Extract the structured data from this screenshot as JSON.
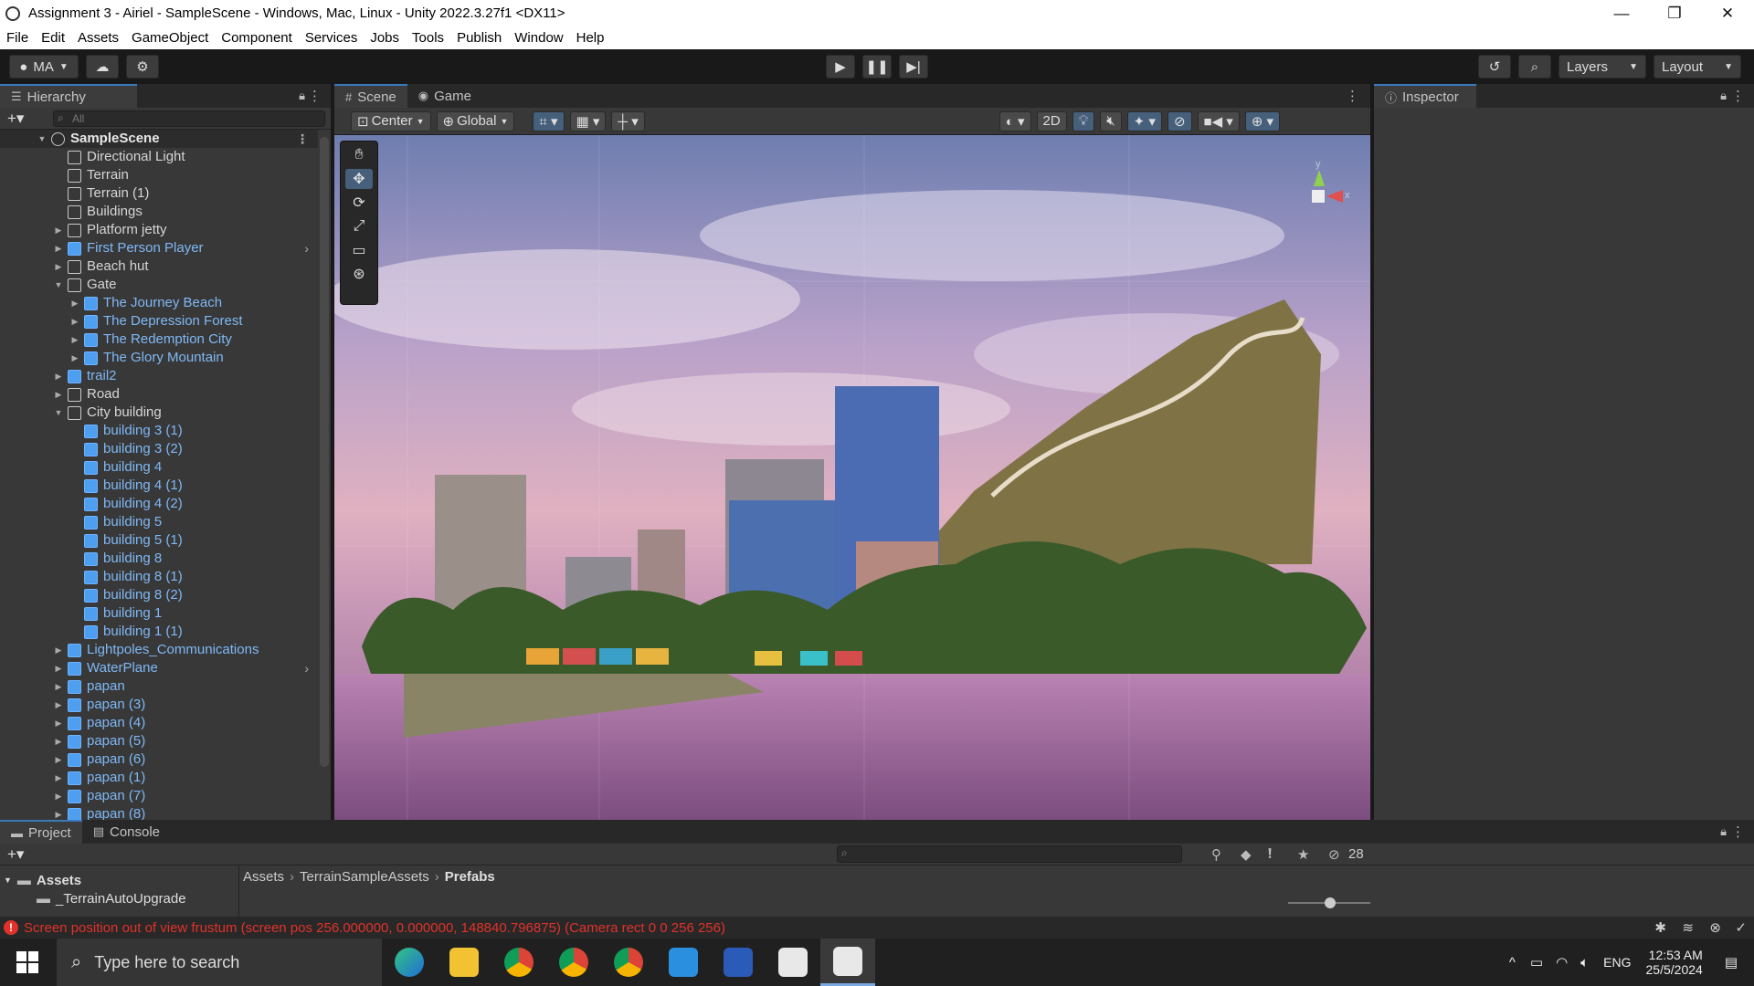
{
  "window": {
    "title": "Assignment 3 - Airiel - SampleScene - Windows, Mac, Linux - Unity 2022.3.27f1 <DX11>",
    "controls": [
      "—",
      "❐",
      "✕"
    ]
  },
  "menu": [
    "File",
    "Edit",
    "Assets",
    "GameObject",
    "Component",
    "Services",
    "Jobs",
    "Tools",
    "Publish",
    "Window",
    "Help"
  ],
  "toolbar": {
    "account": "MA",
    "layers_label": "Layers",
    "layout_label": "Layout"
  },
  "hierarchy": {
    "tab": "Hierarchy",
    "search_placeholder": "All",
    "scene": "SampleScene",
    "items": [
      {
        "label": "Directional Light",
        "depth": 1,
        "arrow": "",
        "prefab": false
      },
      {
        "label": "Terrain",
        "depth": 1,
        "arrow": "",
        "prefab": false
      },
      {
        "label": "Terrain (1)",
        "depth": 1,
        "arrow": "",
        "prefab": false
      },
      {
        "label": "Buildings",
        "depth": 1,
        "arrow": "",
        "prefab": false
      },
      {
        "label": "Platform jetty",
        "depth": 1,
        "arrow": "▶",
        "prefab": false
      },
      {
        "label": "First Person Player",
        "depth": 1,
        "arrow": "▶",
        "prefab": true,
        "more": "›"
      },
      {
        "label": "Beach hut",
        "depth": 1,
        "arrow": "▶",
        "prefab": false
      },
      {
        "label": "Gate",
        "depth": 1,
        "arrow": "▼",
        "prefab": false
      },
      {
        "label": "The Journey Beach",
        "depth": 2,
        "arrow": "▶",
        "prefab": true
      },
      {
        "label": "The Depression Forest",
        "depth": 2,
        "arrow": "▶",
        "prefab": true
      },
      {
        "label": "The Redemption City",
        "depth": 2,
        "arrow": "▶",
        "prefab": true
      },
      {
        "label": "The Glory Mountain",
        "depth": 2,
        "arrow": "▶",
        "prefab": true
      },
      {
        "label": "trail2",
        "depth": 1,
        "arrow": "▶",
        "prefab": true
      },
      {
        "label": "Road",
        "depth": 1,
        "arrow": "▶",
        "prefab": false
      },
      {
        "label": "City building",
        "depth": 1,
        "arrow": "▼",
        "prefab": false
      },
      {
        "label": "building 3 (1)",
        "depth": 2,
        "arrow": "",
        "prefab": true
      },
      {
        "label": "building 3 (2)",
        "depth": 2,
        "arrow": "",
        "prefab": true
      },
      {
        "label": "building 4",
        "depth": 2,
        "arrow": "",
        "prefab": true
      },
      {
        "label": "building 4 (1)",
        "depth": 2,
        "arrow": "",
        "prefab": true
      },
      {
        "label": "building 4 (2)",
        "depth": 2,
        "arrow": "",
        "prefab": true
      },
      {
        "label": "building 5",
        "depth": 2,
        "arrow": "",
        "prefab": true
      },
      {
        "label": "building 5 (1)",
        "depth": 2,
        "arrow": "",
        "prefab": true
      },
      {
        "label": "building 8",
        "depth": 2,
        "arrow": "",
        "prefab": true
      },
      {
        "label": "building 8 (1)",
        "depth": 2,
        "arrow": "",
        "prefab": true
      },
      {
        "label": "building 8 (2)",
        "depth": 2,
        "arrow": "",
        "prefab": true
      },
      {
        "label": "building 1",
        "depth": 2,
        "arrow": "",
        "prefab": true
      },
      {
        "label": "building 1 (1)",
        "depth": 2,
        "arrow": "",
        "prefab": true
      },
      {
        "label": "Lightpoles_Communications",
        "depth": 1,
        "arrow": "▶",
        "prefab": true
      },
      {
        "label": "WaterPlane",
        "depth": 1,
        "arrow": "▶",
        "prefab": true,
        "more": "›"
      },
      {
        "label": "papan",
        "depth": 1,
        "arrow": "▶",
        "prefab": true
      },
      {
        "label": "papan (3)",
        "depth": 1,
        "arrow": "▶",
        "prefab": true
      },
      {
        "label": "papan (4)",
        "depth": 1,
        "arrow": "▶",
        "prefab": true
      },
      {
        "label": "papan (5)",
        "depth": 1,
        "arrow": "▶",
        "prefab": true
      },
      {
        "label": "papan (6)",
        "depth": 1,
        "arrow": "▶",
        "prefab": true
      },
      {
        "label": "papan (1)",
        "depth": 1,
        "arrow": "▶",
        "prefab": true
      },
      {
        "label": "papan (7)",
        "depth": 1,
        "arrow": "▶",
        "prefab": true
      },
      {
        "label": "papan (8)",
        "depth": 1,
        "arrow": "▶",
        "prefab": true
      }
    ]
  },
  "scene_view": {
    "tabs": [
      "Scene",
      "Game"
    ],
    "pivot": "Center",
    "space": "Global",
    "mode_2d": "2D",
    "gizmo_y": "y",
    "gizmo_x": "x"
  },
  "inspector": {
    "tab": "Inspector"
  },
  "project": {
    "tabs": [
      "Project",
      "Console"
    ],
    "breadcrumb": [
      "Assets",
      "TerrainSampleAssets",
      "Prefabs"
    ],
    "tree": [
      "Assets",
      "_TerrainAutoUpgrade"
    ],
    "hidden_count": "28"
  },
  "status": {
    "message": "Screen position out of view frustum (screen pos 256.000000, 0.000000, 148840.796875) (Camera rect 0 0 256 256)"
  },
  "taskbar": {
    "search_placeholder": "Type here to search",
    "lang": "ENG",
    "time": "12:53 AM",
    "date": "25/5/2024"
  },
  "colors": {
    "accent": "#3a79bb",
    "error": "#e0322a",
    "prefab": "#7fb8f5"
  }
}
